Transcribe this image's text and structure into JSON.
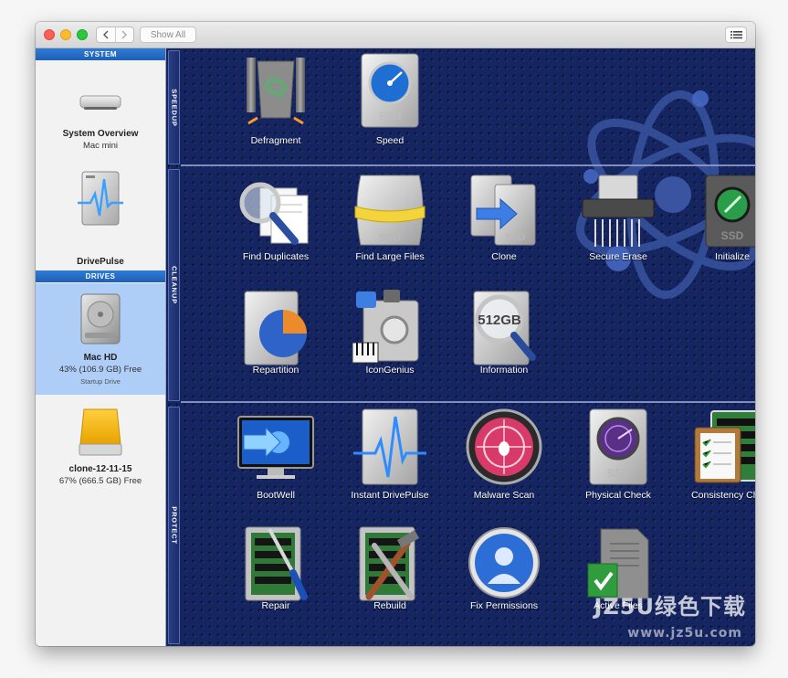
{
  "titlebar": {
    "back_icon": "chevron-left-icon",
    "forward_icon": "chevron-right-icon",
    "show_all_label": "Show All",
    "list_icon": "list-icon"
  },
  "sidebar": {
    "system_header": "SYSTEM",
    "drives_header": "DRIVES",
    "system_items": [
      {
        "name": "System Overview",
        "sub": "Mac mini",
        "icon": "mac-mini-icon"
      },
      {
        "name": "DrivePulse",
        "icon": "drivepulse-icon"
      }
    ],
    "drive_items": [
      {
        "name": "Mac HD",
        "sub": "43% (106.9 GB) Free",
        "note": "Startup Drive",
        "icon": "hard-drive-icon",
        "selected": true
      },
      {
        "name": "clone-12-11-15",
        "sub": "67% (666.5 GB) Free",
        "icon": "external-drive-icon"
      }
    ]
  },
  "sections": {
    "speedup": "SPEEDUP",
    "cleanup": "CLEANUP",
    "protect": "PROTECT"
  },
  "tools": {
    "defragment": "Defragment",
    "speed": "Speed",
    "find_duplicates": "Find Duplicates",
    "find_large_files": "Find Large Files",
    "clone": "Clone",
    "secure_erase": "Secure Erase",
    "initialize": "Initialize",
    "repartition": "Repartition",
    "icongenius": "IconGenius",
    "information": "Information",
    "bootwell": "BootWell",
    "instant_drivepulse": "Instant DrivePulse",
    "malware_scan": "Malware Scan",
    "physical_check": "Physical Check",
    "consistency_check": "Consistency Check",
    "repair": "Repair",
    "rebuild": "Rebuild",
    "fix_permissions": "Fix Permissions",
    "active_files": "Active Files"
  },
  "icon_text": {
    "ssd": "SSD",
    "capacity": "512GB"
  },
  "watermark": {
    "main": "JZ5U绿色下载",
    "sub": "www.jz5u.com"
  },
  "colors": {
    "panel_bg": "#152561",
    "sidebar_header": "#2467c6",
    "selection": "#aecdf7"
  }
}
